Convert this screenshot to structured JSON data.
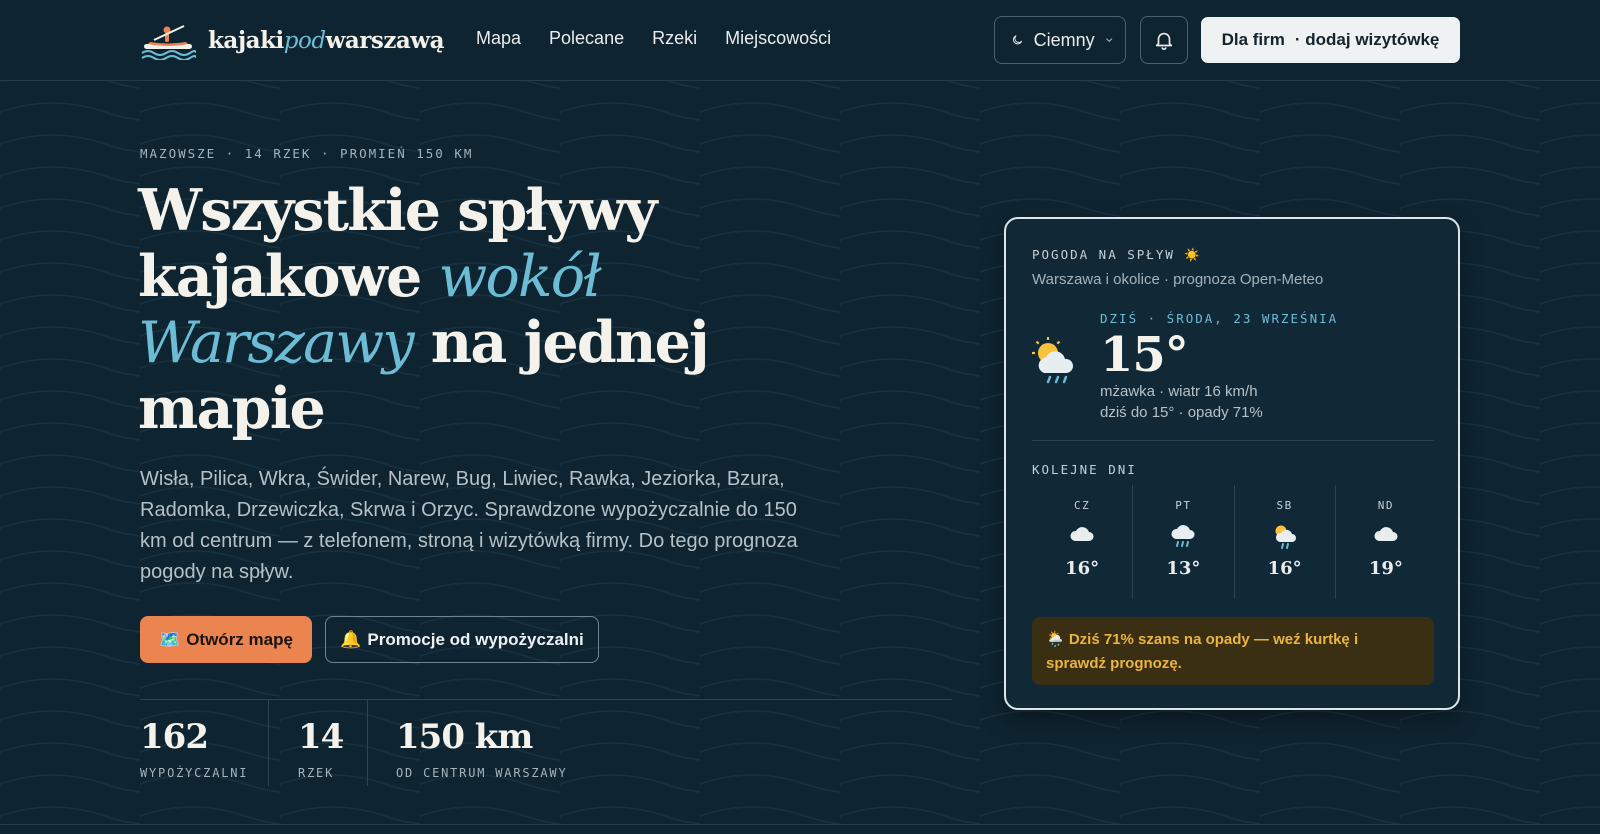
{
  "brand": {
    "part1": "kajaki",
    "part2": "pod",
    "part3": "warszawą"
  },
  "nav": [
    "Mapa",
    "Polecane",
    "Rzeki",
    "Miejscowości"
  ],
  "theme": {
    "selected": "Ciemny",
    "icon": "moon-icon"
  },
  "header_actions": {
    "bell_icon": "bell-icon",
    "firms_label": "Dla firm",
    "firms_sub": "· dodaj wizytówkę"
  },
  "hero": {
    "kicker": "MAZOWSZE · 14 RZEK · PROMIEŃ 150 KM",
    "title_parts": [
      "Wszystkie spływy kajakowe ",
      "wokół Warszawy",
      " na jednej mapie"
    ],
    "lead": "Wisła, Pilica, Wkra, Świder, Narew, Bug, Liwiec, Rawka, Jeziorka, Bzura, Radomka, Drzewiczka, Skrwa i Orzyc. Sprawdzone wypożyczalnie do 150 km od centrum — z telefonem, stroną i wizytówką firmy. Do tego prognoza pogody na spływ.",
    "btn_map": "Otwórz mapę",
    "btn_map_icon": "🗺️",
    "btn_promo": "Promocje od wypożyczalni",
    "btn_promo_icon": "🔔"
  },
  "stats": [
    {
      "value": "162",
      "label": "WYPOŻYCZALNI"
    },
    {
      "value": "14",
      "label": "RZEK"
    },
    {
      "value": "150 km",
      "label": "OD CENTRUM WARSZAWY"
    }
  ],
  "weather": {
    "title": "POGODA NA SPŁYW ☀️",
    "subtitle": "Warszawa i okolice · prognoza Open-Meteo",
    "today": {
      "date": "DZIŚ · ŚRODA, 23 WRZEŚNIA",
      "temp": "15°",
      "condition": "mżawka · wiatr 16 km/h",
      "range": "dziś do 15° · opady 71%",
      "icon": "sun-cloud-rain-icon"
    },
    "next_title": "KOLEJNE DNI",
    "days": [
      {
        "name": "CZ",
        "temp": "16°",
        "icon": "cloud-icon"
      },
      {
        "name": "PT",
        "temp": "13°",
        "icon": "cloud-rain-icon"
      },
      {
        "name": "SB",
        "temp": "16°",
        "icon": "sun-cloud-rain-icon"
      },
      {
        "name": "ND",
        "temp": "19°",
        "icon": "cloud-icon"
      }
    ],
    "alert": "🌦️ Dziś 71% szans na opady — weź kurtkę i sprawdź prognozę."
  },
  "colors": {
    "background": "#0f2431",
    "accent": "#6cbcd6",
    "cta": "#ec844f",
    "alert_bg": "#3a2f12",
    "alert_text": "#e9b443"
  }
}
